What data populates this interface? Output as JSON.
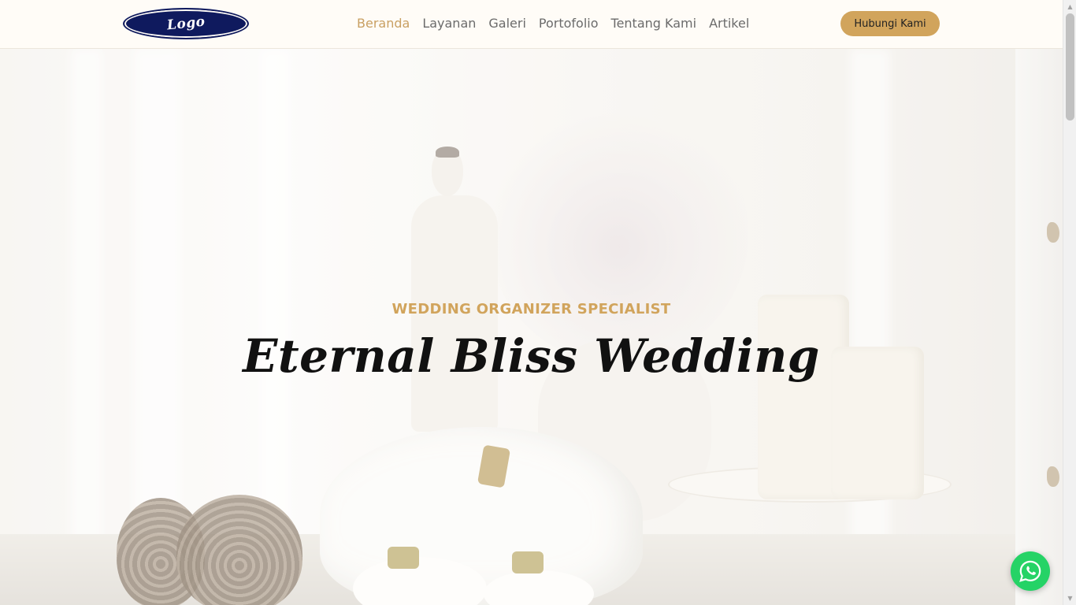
{
  "header": {
    "logo_text": "Logo",
    "nav": [
      {
        "label": "Beranda",
        "active": true
      },
      {
        "label": "Layanan",
        "active": false
      },
      {
        "label": "Galeri",
        "active": false
      },
      {
        "label": "Portofolio",
        "active": false
      },
      {
        "label": "Tentang Kami",
        "active": false
      },
      {
        "label": "Artikel",
        "active": false
      }
    ],
    "cta_label": "Hubungi Kami"
  },
  "hero": {
    "subtitle": "WEDDING ORGANIZER SPECIALIST",
    "title": "Eternal Bliss Wedding"
  },
  "floating": {
    "whatsapp_icon": "whatsapp-icon"
  },
  "colors": {
    "accent": "#d1a45c",
    "logo_bg": "#0f1a5e",
    "whatsapp": "#25d366",
    "nav_text": "#6b6b6b",
    "title_text": "#111111"
  }
}
